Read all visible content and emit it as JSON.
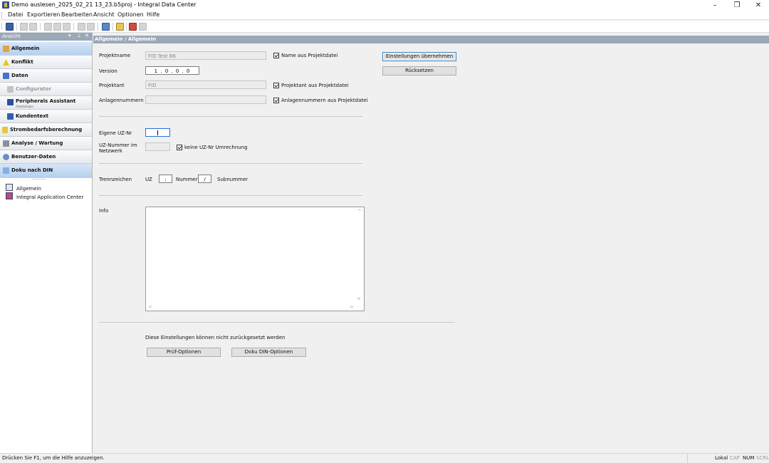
{
  "window": {
    "title": "Demo auslesen_2025_02_21 13_23.b5proj - Integral Data Center",
    "minimize": "–",
    "maximize": "❐",
    "close": "✕"
  },
  "menu": [
    "Datei",
    "Exportieren",
    "Bearbeiten",
    "Ansicht",
    "Optionen",
    "Hilfe"
  ],
  "left_pane": {
    "title": "Ansicht",
    "controls": [
      "▾",
      "⊥",
      "✕"
    ],
    "nav_items": [
      {
        "label": "Allgemein",
        "icon": "general-icon"
      },
      {
        "label": "Konflikt",
        "icon": "warning-icon"
      },
      {
        "label": "Daten",
        "icon": "data-icon"
      },
      {
        "label": "Configurator",
        "icon": "configurator-icon"
      },
      {
        "label": "Peripherals Assistant",
        "sub": "Arbeitskopie",
        "icon": "peripherals-icon"
      },
      {
        "label": "Kundentext",
        "icon": "customer-text-icon"
      },
      {
        "label": "Strombedarfsberechnung",
        "icon": "power-icon"
      },
      {
        "label": "Analyse / Wartung",
        "icon": "tools-icon"
      },
      {
        "label": "Benutzer-Daten",
        "icon": "users-icon"
      },
      {
        "label": "Doku nach DIN",
        "icon": "doc-icon"
      }
    ],
    "dots": "··········",
    "tree": [
      "Allgemein",
      "Integral Application Center"
    ]
  },
  "content": {
    "header": "Allgemein / Allgemein",
    "projektname_label": "Projektname",
    "projektname_value": "FID Test B6",
    "name_aus_projektdatei": "Name aus Projektdatei",
    "version_label": "Version",
    "version_value": "1 . 0 . 0 . 0",
    "projektant_label": "Projektant",
    "projektant_value": "FID",
    "projektant_aus_projektdatei": "Projektant aus Projektdatei",
    "anlagennummern_label": "Anlagennummern",
    "anlagennummern_aus_projektdatei": "Anlagennummern aus Projektdatei",
    "btn_uebernehmen": "Einstellungen übernehmen",
    "btn_ruecksetzen": "Rücksetzen",
    "eigene_uz_label": "Eigene UZ-Nr",
    "uz_nummer_label": "UZ-Nummer im Netzwerk",
    "keine_uz_umrechnung": "keine UZ-Nr Umrechnung",
    "trennzeichen_label": "Trennzeichen",
    "uz_label": "UZ",
    "uz_sep_value": ":",
    "nummer_label": "Nummer",
    "nummer_sep_value": "/",
    "subnummer_label": "Subnummer",
    "info_label": "Info",
    "scroll_up": "^",
    "scroll_down": "v",
    "scroll_left": "<",
    "scroll_right": ">",
    "note": "Diese Einstellungen können nicht zurückgesetzt werden",
    "btn_pruef": "Prüf-Optionen",
    "btn_doku": "Doku DIN-Optionen"
  },
  "status": {
    "text": "Drücken Sie F1, um die Hilfe anzuzeigen.",
    "indicators": [
      "Lokal",
      "CAP",
      "NUM",
      "SCRL"
    ]
  },
  "colors": {
    "pane_header": "#9aa8b8",
    "selected_nav": "#b5d0ee",
    "focus_border": "#2a6fd6"
  }
}
